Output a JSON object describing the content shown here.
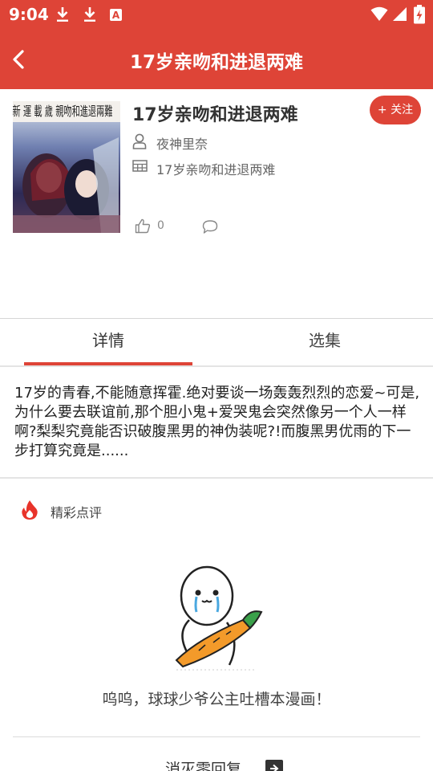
{
  "status_bar": {
    "time": "9:04",
    "badge_letter": "A",
    "icons": [
      "download-icon",
      "download-icon",
      "a-badge-icon",
      "wifi-icon",
      "signal-icon",
      "battery-charging-icon"
    ]
  },
  "header": {
    "title": "17岁亲吻和进退两难",
    "back_icon": "chevron-left-icon"
  },
  "book": {
    "cover_text": "新 運 載  歲  親吻和進退兩難",
    "title": "17岁亲吻和进退两难",
    "follow_label": "+ 关注",
    "author": "夜神里奈",
    "chapter": "17岁亲吻和进退两难",
    "likes": "0"
  },
  "tabs": [
    {
      "label": "详情",
      "active": true
    },
    {
      "label": "选集",
      "active": false
    }
  ],
  "description": "17岁的青春,不能随意挥霍.绝对要谈一场轰轰烈烈的恋爱~可是,为什么要去联谊前,那个胆小鬼+爱哭鬼会突然像另一个人一样啊?梨梨究竟能否识破腹黑男的神伪装呢?!而腹黑男优雨的下一步打算究竟是......",
  "comments": {
    "section_title": "精彩点评",
    "empty_text": "呜呜，球球少爷公主吐槽本漫画！",
    "bottom_action": "消灭零回复"
  },
  "colors": {
    "accent": "#de4437",
    "divider": "#e4e4e4",
    "text": "#333333"
  }
}
